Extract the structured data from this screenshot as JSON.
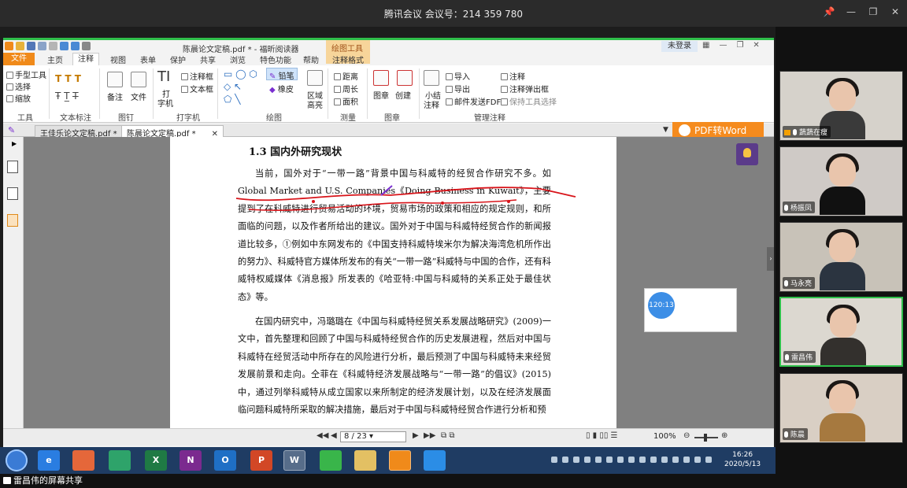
{
  "meeting": {
    "title": "腾讯会议 会议号：214 359 780",
    "share_label": "雷昌伟的屏幕共享"
  },
  "window_controls": {
    "pin": "📌",
    "minimize": "—",
    "restore": "❐",
    "close": "✕"
  },
  "foxit": {
    "doc_title": "陈晨论文定稿.pdf * - 福昕阅读器",
    "context_tab": "绘图工具",
    "login": "未登录",
    "tabs": [
      "文件",
      "主页",
      "注释",
      "视图",
      "表单",
      "保护",
      "共享",
      "浏览",
      "特色功能",
      "帮助",
      "注释格式"
    ],
    "search_placeholder": "查找",
    "ribbon": {
      "tools": [
        "手型工具",
        "选择",
        "缩放"
      ],
      "text_markup_label": "文本标注",
      "tools_label": "工具",
      "pin_items": [
        "备注",
        "文件"
      ],
      "pin_label": "图钉",
      "typewriter": [
        "打",
        "字机"
      ],
      "typewriter_items": [
        "注释框",
        "文本框"
      ],
      "typewriter_label": "打字机",
      "drawing_label": "绘图",
      "pencil": "铅笔",
      "eraser": "橡皮",
      "area_highlight": [
        "区域",
        "高亮"
      ],
      "measure_items": [
        "距离",
        "周长",
        "面积"
      ],
      "measure_label": "测量",
      "stamp_items": [
        "图章",
        "创建"
      ],
      "stamp_label": "图章",
      "summary": [
        "小结",
        "注释"
      ],
      "manage_items": [
        "导入",
        "导出",
        "邮件发送FDF"
      ],
      "manage_items2": [
        "注释",
        "注释弹出框",
        "保持工具选择"
      ],
      "manage_label": "管理注释"
    },
    "doc_tabs": [
      "王佳乐论文定稿.pdf *",
      "陈晨论文定稿.pdf *"
    ],
    "pdf_to_word": "PDF转Word",
    "document": {
      "heading": "1.3 国内外研究现状",
      "paragraph1": "当前，国外对于“一带一路”背景中国与科威特的经贸合作研究不多。如Global Market and U.S. Companies《Doing Business in Kuwait》，主要提到了在科威特进行贸易活动的环境，贸易市场的政策和相应的规定规则，和所面临的问题，以及作者所给出的建议。国外对于中国与科威特经贸合作的新闻报道比较多，①例如中东网发布的《中国支持科威特埃米尔为解决海湾危机所作出的努力》、科威特官方媒体所发布的有关“一带一路”科威特与中国的合作，还有科威特权威媒体《消息报》所发表的《哈亚特:中国与科威特的关系正处于最佳状态》等。",
      "paragraph2": "在国内研究中，冯璐璐在《中国与科威特经贸关系发展战略研究》(2009)一文中，首先整理和回顾了中国与科威特经贸合作的历史发展进程，然后对中国与科威特在经贸活动中所存在的风险进行分析，最后预测了中国与科威特未来经贸发展前景和走向。仝菲在《科威特经济发展战略与“一带一路”的倡议》(2015)中，通过列举科威特从成立国家以来所制定的经济发展计划，以及在经济发展面临问题科威特所采取的解决措施，最后对于中国与科威特经贸合作进行分析和预"
    },
    "timer": "120:13",
    "status": {
      "page": "8 / 23",
      "zoom": "100%"
    }
  },
  "taskbar": {
    "apps": [
      "e",
      "X",
      "N",
      "O",
      "P",
      "W"
    ],
    "clock_time": "16:26",
    "clock_date": "2020/5/13"
  },
  "participants": [
    {
      "name": "蔬蔬在瘦",
      "shirt": "#3a3a3a",
      "bg": "#d6d2cb"
    },
    {
      "name": "杨振凤",
      "shirt": "#111111",
      "bg": "#cfcac6"
    },
    {
      "name": "马永亮",
      "shirt": "#2b3440",
      "bg": "#c8c2b8"
    },
    {
      "name": "雷昌伟",
      "shirt": "#33302d",
      "bg": "#dcd8d0"
    },
    {
      "name": "陈晨",
      "shirt": "#a6793f",
      "bg": "#d9cfc4"
    }
  ],
  "colors": {
    "accent": "#f08a1a",
    "speaker_border": "#2fbf4a",
    "ink_red": "#d8141a",
    "ink_purple": "#7a2fd0"
  }
}
